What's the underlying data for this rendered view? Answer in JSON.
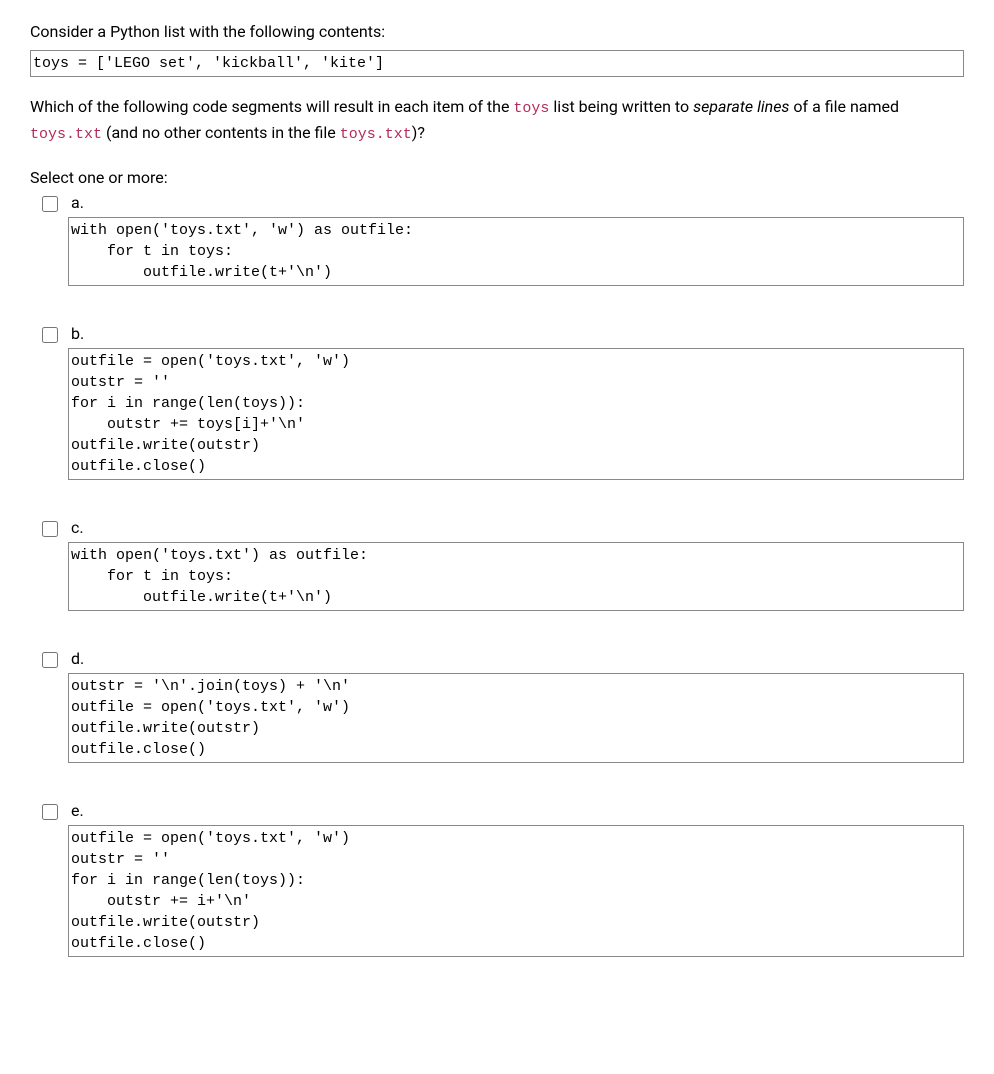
{
  "intro": {
    "line1": "Consider a Python list with the following contents:",
    "code": "toys = ['LEGO set', 'kickball', 'kite']",
    "q_prefix": "Which of the following code segments will result in each item of the ",
    "q_code1": "toys",
    "q_mid1": " list being written to ",
    "q_italic": "separate lines",
    "q_mid2": " of a file named ",
    "q_code2": "toys.txt",
    "q_mid3": " (and no other contents in the file ",
    "q_code3": "toys.txt",
    "q_end": ")?"
  },
  "select_prompt": "Select one or more:",
  "options": [
    {
      "label": "a.",
      "code": "with open('toys.txt', 'w') as outfile:\n    for t in toys:\n        outfile.write(t+'\\n')"
    },
    {
      "label": "b.",
      "code": "outfile = open('toys.txt', 'w')\noutstr = ''\nfor i in range(len(toys)):\n    outstr += toys[i]+'\\n'\noutfile.write(outstr)\noutfile.close()"
    },
    {
      "label": "c.",
      "code": "with open('toys.txt') as outfile:\n    for t in toys:\n        outfile.write(t+'\\n')"
    },
    {
      "label": "d.",
      "code": "outstr = '\\n'.join(toys) + '\\n'\noutfile = open('toys.txt', 'w')\noutfile.write(outstr)\noutfile.close()"
    },
    {
      "label": "e.",
      "code": "outfile = open('toys.txt', 'w')\noutstr = ''\nfor i in range(len(toys)):\n    outstr += i+'\\n'\noutfile.write(outstr)\noutfile.close()"
    }
  ]
}
